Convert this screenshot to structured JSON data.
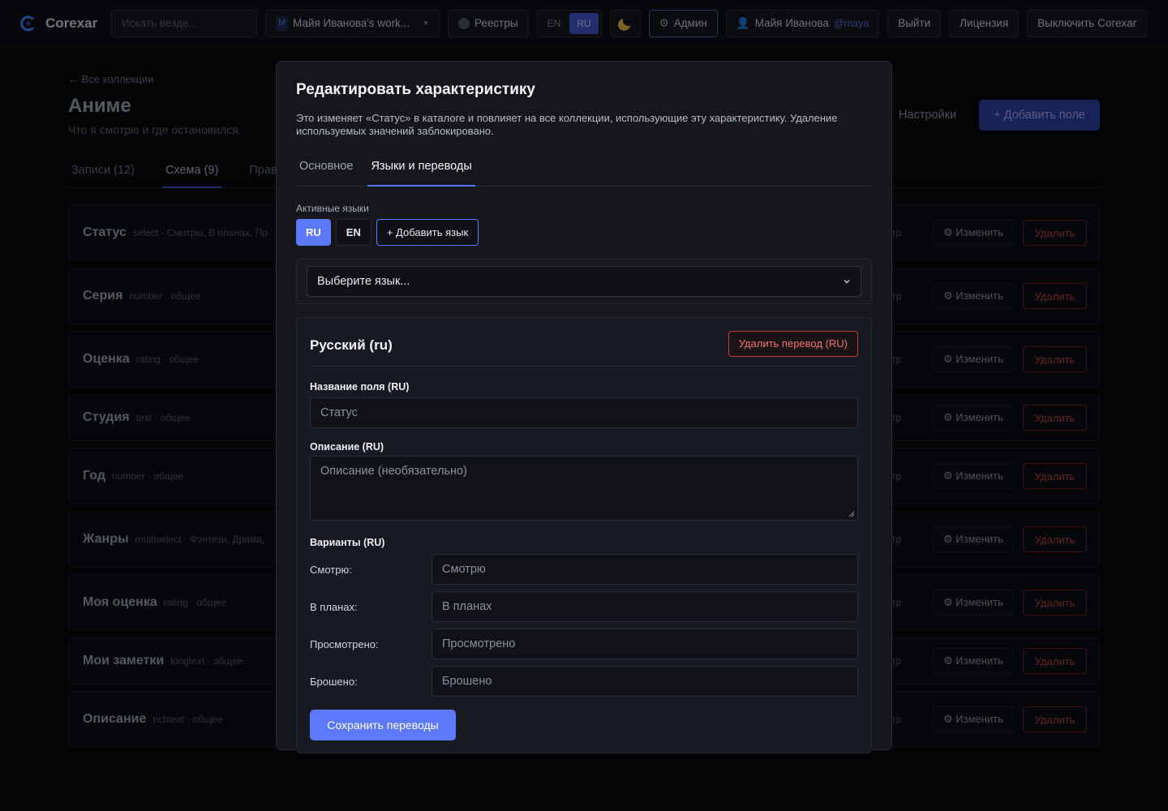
{
  "topbar": {
    "app_name": "Corexar",
    "search_placeholder": "Искать везде...",
    "workspace_initial": "M",
    "workspace_name": "Майя Иванова's work...",
    "registries_label": "Реестры",
    "lang_en": "EN",
    "lang_ru": "RU",
    "active_lang": "RU",
    "theme_icon": "moon-icon",
    "admin_label": "Админ",
    "user_name": "Майя Иванова",
    "user_handle": "@maya",
    "logout_label": "Выйти",
    "license_label": "Лицензия",
    "shutdown_label": "Выключить Corexar"
  },
  "page": {
    "back_link": "← Все коллекции",
    "title": "Аниме",
    "subtitle": "Что я смотрю и где остановился.",
    "tabs": [
      "Записи (12)",
      "Схема (9)",
      "Прави"
    ],
    "active_tab": 1,
    "settings_label": "Настройки",
    "add_field_label": "+ Добавить поле",
    "row_tr_label": "тр",
    "row_edit_label": "⚙ Изменить",
    "row_delete_label": "Удалить",
    "fields": [
      {
        "name": "Статус",
        "meta": "select · Смотрю, В планах, Пр"
      },
      {
        "name": "Серия",
        "meta": "number · общее"
      },
      {
        "name": "Оценка",
        "meta": "rating · общее"
      },
      {
        "name": "Студия",
        "meta": "text · общее"
      },
      {
        "name": "Год",
        "meta": "number · общее"
      },
      {
        "name": "Жанры",
        "meta": "multiselect · Фэнтези, Драма,"
      },
      {
        "name": "Моя оценка",
        "meta": "rating · общее"
      },
      {
        "name": "Мои заметки",
        "meta": "longtext · общее"
      },
      {
        "name": "Описание",
        "meta": "richtext · общее"
      }
    ]
  },
  "modal": {
    "title": "Редактировать характеристику",
    "description": "Это изменяет «Статус» в каталоге и повлияет на все коллекции, использующие эту характеристику. Удаление используемых значений заблокировано.",
    "tabs": [
      "Основное",
      "Языки и переводы"
    ],
    "active_tab": 1,
    "active_langs_label": "Активные языки",
    "lang_chips": [
      "RU",
      "EN"
    ],
    "add_lang_label": "+ Добавить язык",
    "select_placeholder": "Выберите язык...",
    "translation": {
      "title": "Русский (ru)",
      "delete_label": "Удалить перевод (RU)",
      "name_label": "Название поля (RU)",
      "name_value": "Статус",
      "desc_label": "Описание (RU)",
      "desc_placeholder": "Описание (необязательно)",
      "options_label": "Варианты (RU)",
      "options": [
        {
          "label": "Смотрю:",
          "value": "Смотрю"
        },
        {
          "label": "В планах:",
          "value": "В планах"
        },
        {
          "label": "Просмотрено:",
          "value": "Просмотрено"
        },
        {
          "label": "Брошено:",
          "value": "Брошено"
        }
      ],
      "save_label": "Сохранить переводы"
    }
  },
  "colors": {
    "accent": "#5b79fa",
    "danger": "#f87171",
    "background": "#000000",
    "modal_bg": "#15171d"
  }
}
